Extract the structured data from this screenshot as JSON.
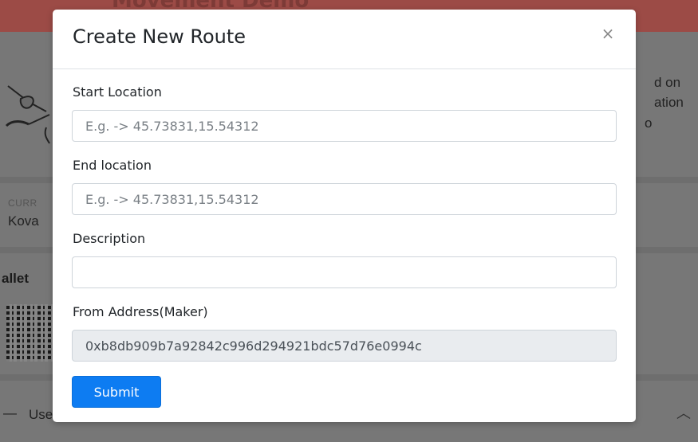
{
  "background": {
    "header_text": "Movement Demo",
    "side_text_lines": [
      "d on",
      "ation",
      "o"
    ],
    "network_label": "CURR",
    "network_value": "Kova",
    "wallet_label": "allet",
    "bottom_item": "Use",
    "overlay_color": "#777777"
  },
  "modal": {
    "title": "Create New Route",
    "close_symbol": "×",
    "fields": [
      {
        "label": "Start Location",
        "placeholder": "E.g. -> 45.73831,15.54312",
        "value": ""
      },
      {
        "label": "End location",
        "placeholder": "E.g. -> 45.73831,15.54312",
        "value": ""
      },
      {
        "label": "Description",
        "placeholder": "",
        "value": ""
      },
      {
        "label": "From Address(Maker)",
        "placeholder": "",
        "value": "0xb8db909b7a92842c996d294921bdc57d76e0994c"
      }
    ],
    "submit_label": "Submit",
    "submit_color": "#0d7cf2"
  }
}
